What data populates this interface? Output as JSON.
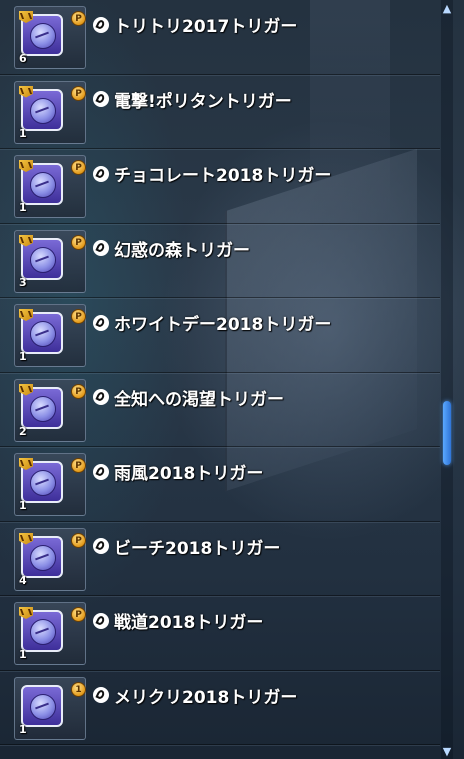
{
  "items": [
    {
      "name": "トリトリ2017トリガー",
      "count": "6",
      "badge": "P",
      "ribbon": true
    },
    {
      "name": "電撃!ポリタントリガー",
      "count": "1",
      "badge": "P",
      "ribbon": true
    },
    {
      "name": "チョコレート2018トリガー",
      "count": "1",
      "badge": "P",
      "ribbon": true
    },
    {
      "name": "幻惑の森トリガー",
      "count": "3",
      "badge": "P",
      "ribbon": true
    },
    {
      "name": "ホワイトデー2018トリガー",
      "count": "1",
      "badge": "P",
      "ribbon": true
    },
    {
      "name": "全知への渇望トリガー",
      "count": "2",
      "badge": "P",
      "ribbon": true
    },
    {
      "name": "雨風2018トリガー",
      "count": "1",
      "badge": "P",
      "ribbon": true
    },
    {
      "name": "ビーチ2018トリガー",
      "count": "4",
      "badge": "P",
      "ribbon": true
    },
    {
      "name": "戦道2018トリガー",
      "count": "1",
      "badge": "P",
      "ribbon": true
    },
    {
      "name": "メリクリ2018トリガー",
      "count": "1",
      "badge": "1",
      "ribbon": false
    }
  ],
  "icons": {
    "item": "trigger-disc-icon",
    "ribbon": "ribbon-icon",
    "badge": "rarity-badge-icon",
    "type": "key-type-icon"
  },
  "scrollbar": {
    "position_fraction": 0.58
  },
  "colors": {
    "accent": "#4a8fe8",
    "badge": "#e39a1a",
    "text": "#ffffff"
  }
}
